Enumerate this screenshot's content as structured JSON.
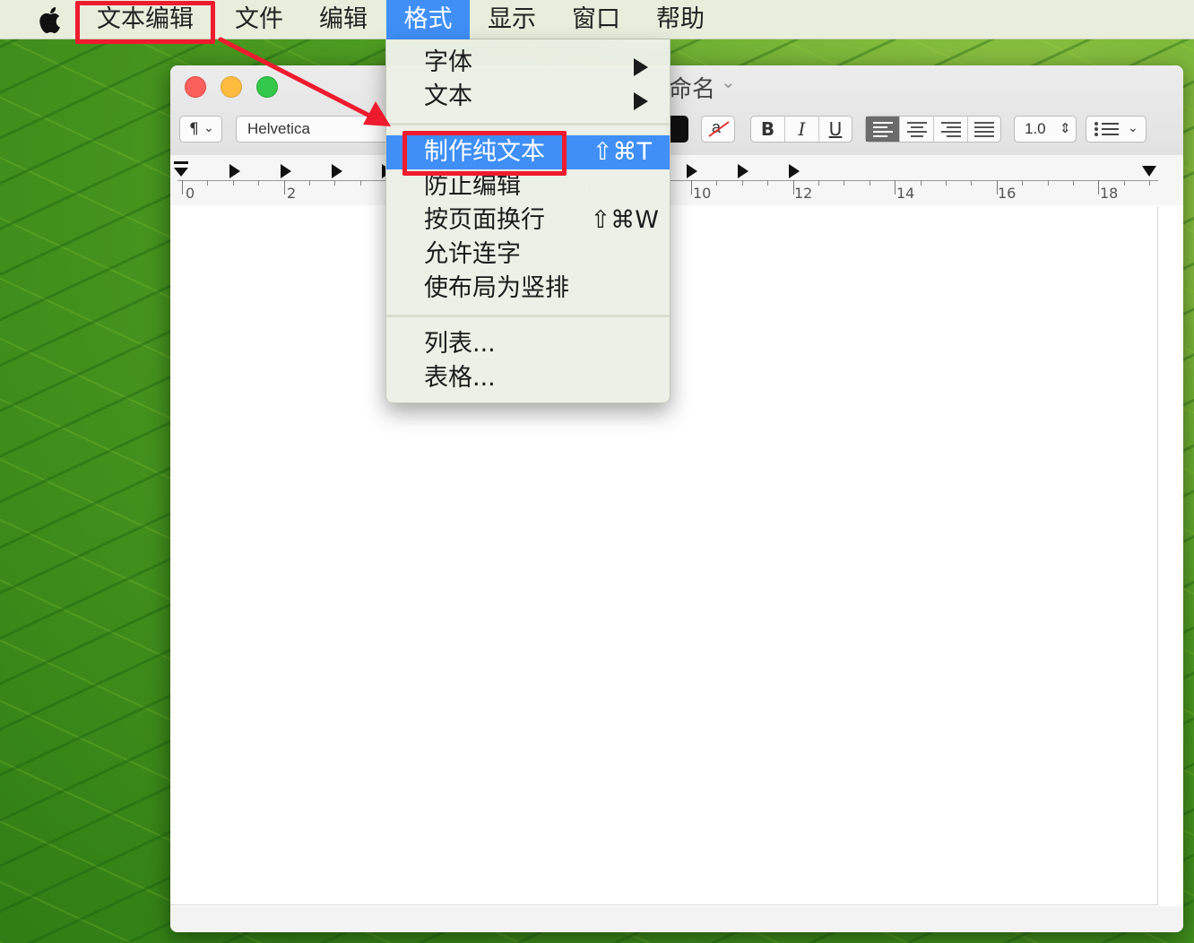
{
  "menubar": {
    "apple_icon": "apple-logo-icon",
    "items": [
      "文本编辑",
      "文件",
      "编辑",
      "格式",
      "显示",
      "窗口",
      "帮助"
    ],
    "active_index": 3
  },
  "window": {
    "title": "命名",
    "toolbar": {
      "paragraph_style": "¶",
      "font": "Helvetica",
      "bold": "B",
      "italic": "I",
      "underline": "U",
      "strike_sample": "a",
      "line_spacing": "1.0",
      "list_icon": "list-bullets-icon"
    },
    "ruler": {
      "labels": [
        "0",
        "2",
        "10",
        "12",
        "14",
        "16",
        "18"
      ]
    }
  },
  "format_menu": {
    "items": [
      {
        "label": "字体",
        "submenu": true
      },
      {
        "label": "文本",
        "submenu": true
      },
      {
        "label": "制作纯文本",
        "shortcut": "⇧⌘T",
        "highlighted": true
      },
      {
        "label": "防止编辑",
        "shortcut": ""
      },
      {
        "label": "按页面换行",
        "shortcut": "⇧⌘W"
      },
      {
        "label": "允许连字",
        "shortcut": ""
      },
      {
        "label": "使布局为竖排",
        "shortcut": ""
      },
      {
        "label": "列表...",
        "shortcut": ""
      },
      {
        "label": "表格...",
        "shortcut": ""
      }
    ]
  },
  "colors": {
    "highlight": "#3f8ff7",
    "annotation_red": "#ee1b2e"
  }
}
